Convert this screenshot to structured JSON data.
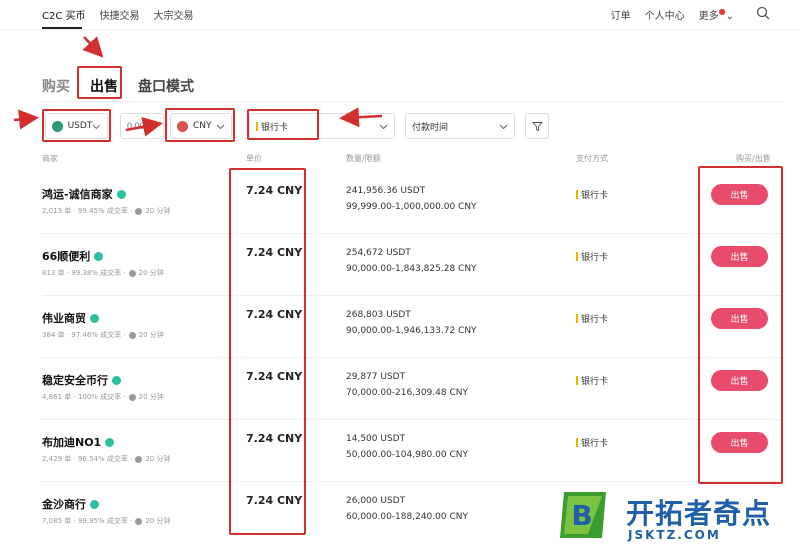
{
  "topnav": {
    "left": [
      "C2C 买币",
      "快捷交易",
      "大宗交易"
    ],
    "right": [
      "订单",
      "个人中心",
      "更多"
    ]
  },
  "tabs": [
    "购买",
    "出售",
    "盘口模式"
  ],
  "filters": {
    "coin": "USDT",
    "amount_placeholder": "0.00",
    "fiat": "CNY",
    "payment": "银行卡",
    "time": "付款时间"
  },
  "table": {
    "headers": [
      "商家",
      "单价",
      "数量/限额",
      "支付方式",
      "购买/出售"
    ],
    "rows": [
      {
        "name": "鸿运-诚信商家",
        "stats": "2,013 单 · 99.45% 成交率 ·",
        "time": "20 分钟",
        "price": "7.24 CNY",
        "qty": "241,956.36 USDT",
        "limit": "99,999.00-1,000,000.00 CNY",
        "pay": "银行卡",
        "action": "出售"
      },
      {
        "name": "66顺便利",
        "stats": "813 单 · 99.38% 成交率 ·",
        "time": "20 分钟",
        "price": "7.24 CNY",
        "qty": "254,672 USDT",
        "limit": "90,000.00-1,843,825.28 CNY",
        "pay": "银行卡",
        "action": "出售"
      },
      {
        "name": "伟业商贸",
        "stats": "384 单 · 97.46% 成交率 ·",
        "time": "20 分钟",
        "price": "7.24 CNY",
        "qty": "268,803 USDT",
        "limit": "90,000.00-1,946,133.72 CNY",
        "pay": "银行卡",
        "action": "出售"
      },
      {
        "name": "稳定安全币行",
        "stats": "4,861 单 · 100% 成交率 ·",
        "time": "20 分钟",
        "price": "7.24 CNY",
        "qty": "29,877 USDT",
        "limit": "70,000.00-216,309.48 CNY",
        "pay": "银行卡",
        "action": "出售"
      },
      {
        "name": "布加迪NO1",
        "stats": "2,429 单 · 96.54% 成交率 ·",
        "time": "20 分钟",
        "price": "7.24 CNY",
        "qty": "14,500 USDT",
        "limit": "50,000.00-104,980.00 CNY",
        "pay": "银行卡",
        "action": "出售"
      },
      {
        "name": "金沙商行",
        "stats": "7,085 单 · 99.95% 成交率 ·",
        "time": "20 分钟",
        "price": "7.24 CNY",
        "qty": "26,000 USDT",
        "limit": "60,000.00-188,240.00 CNY",
        "pay": "",
        "action": ""
      }
    ]
  },
  "watermark": {
    "title": "开拓者奇点",
    "domain": "JSKTZ.COM",
    "letter": "B"
  },
  "colors": {
    "sell": "#e94b6c",
    "annotation": "#d32f2f",
    "brand": "#1f5ea8"
  }
}
